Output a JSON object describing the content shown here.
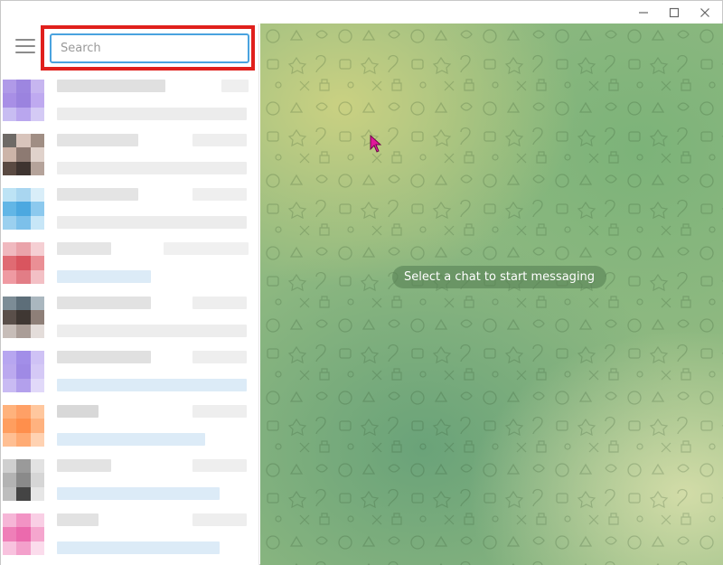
{
  "window": {
    "controls": {
      "minimize": "minimize",
      "maximize": "maximize",
      "close": "close"
    }
  },
  "sidebar": {
    "menu_icon": "hamburger-menu-icon",
    "search": {
      "placeholder": "Search",
      "value": ""
    }
  },
  "main": {
    "empty_state": "Select a chat to start messaging",
    "background_pattern": "doodle-pattern"
  },
  "colors": {
    "search_focus": "#4aa3df",
    "highlight": "#e0201c",
    "pill_bg": "#58825a"
  },
  "chats": [
    {
      "avatar": [
        "#b09ae8",
        "#9d86e0",
        "#c7b6f0",
        "#a88fe6",
        "#9b83df",
        "#bfaaf0",
        "#c8bdf2",
        "#b9a6ee",
        "#d4caf5"
      ]
    },
    {
      "avatar": [
        "#6e6a66",
        "#d8c4bb",
        "#a08e84",
        "#ccb4a8",
        "#8d7a72",
        "#e0d2cb",
        "#5a4a42",
        "#3e3430",
        "#b5a39a"
      ]
    },
    {
      "avatar": [
        "#bde3f5",
        "#a9d6f0",
        "#d9eef9",
        "#62b6e6",
        "#4ca8e0",
        "#8cc9ee",
        "#9bd0ef",
        "#7cc0ea",
        "#c7e6f7"
      ]
    },
    {
      "avatar": [
        "#f0b9bf",
        "#eaa3aa",
        "#f5cfd3",
        "#e06b73",
        "#d9555f",
        "#ea8f95",
        "#ef9aa2",
        "#e27d86",
        "#f3c0c5"
      ]
    },
    {
      "avatar": [
        "#7c8c96",
        "#5d6e79",
        "#aab7bf",
        "#5a4f4a",
        "#3f3733",
        "#8e7f78",
        "#c7bdb8",
        "#aa9d97",
        "#e4ddda"
      ]
    },
    {
      "avatar": [
        "#b7a6f0",
        "#a28ee8",
        "#cfc2f5",
        "#bba9ef",
        "#9f8ae5",
        "#d5c9f6",
        "#c9bbf3",
        "#b3a0ec",
        "#e1d9f9"
      ]
    },
    {
      "avatar": [
        "#ffb27c",
        "#ffa066",
        "#ffc79e",
        "#ff9e5f",
        "#ff8f4c",
        "#ffb27f",
        "#ffbf93",
        "#ffab74",
        "#ffd2b2"
      ]
    },
    {
      "avatar": [
        "#cfcfcf",
        "#9a9a9a",
        "#e2e2e2",
        "#b3b3b3",
        "#8a8a8a",
        "#d6d6d6",
        "#bdbdbd",
        "#444444",
        "#e6e6e6"
      ]
    },
    {
      "avatar": [
        "#f6b6d7",
        "#f293c4",
        "#f9cfe5",
        "#ef7fb8",
        "#eb6aad",
        "#f5a6ce",
        "#f8c2de",
        "#f3a0cb",
        "#fbdcec"
      ]
    }
  ]
}
